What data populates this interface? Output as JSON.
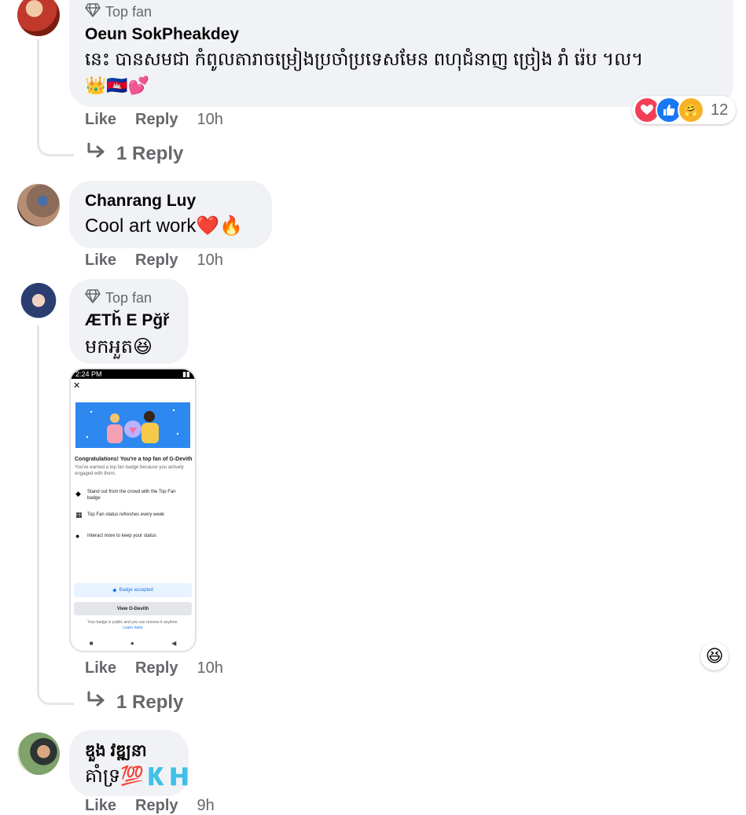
{
  "comments": [
    {
      "badge": "Top fan",
      "author": "Oeun SokPheakdey",
      "text": "នេះ បានសមជា កំពូលតារាចម្រៀងប្រចាំប្រទេសមែន ពហុជំនាញ ច្រៀង រាំ រ៉េប ។ល។",
      "emojis": "👑🇰🇭💕",
      "actions": {
        "like": "Like",
        "reply": "Reply",
        "time": "10h"
      },
      "reactions": {
        "icons": [
          "heart",
          "like",
          "care"
        ],
        "count": "12"
      },
      "replies_link": "1 Reply"
    },
    {
      "author": "Chanrang Luy",
      "text": "Cool art work❤️🔥",
      "actions": {
        "like": "Like",
        "reply": "Reply",
        "time": "10h"
      }
    },
    {
      "badge": "Top fan",
      "author": "ÆTȟ E Pğř",
      "text": "មកអួត😆",
      "actions": {
        "like": "Like",
        "reply": "Reply",
        "time": "10h"
      },
      "reaction_emoji": "😆",
      "replies_link": "1 Reply",
      "attachment": {
        "status_time": "2:24 PM",
        "heading": "Congratulations! You're a top fan of G-Devith",
        "subtext": "You've earned a top fan badge because you actively engaged with them.",
        "item1": "Stand out from the crowd with the Top Fan badge",
        "item2": "Top Fan status refreshes every week",
        "item3": "Interact more to keep your status",
        "badge_button": "Badge accepted",
        "view_button": "View G-Devith",
        "footer": "Your badge is public and you can remove it anytime.",
        "learn_more": "Learn more"
      }
    },
    {
      "author": "ឌួង វឌ្ឍនា",
      "text": "គាំទ្រ💯🇰🇭",
      "actions": {
        "like": "Like",
        "reply": "Reply",
        "time": "9h"
      }
    }
  ],
  "colors": {
    "bubble": "#f0f2f5",
    "secondary_text": "#65676b",
    "like_blue": "#1877f2",
    "love_red": "#f33e58",
    "care_yellow": "#f7b125"
  }
}
